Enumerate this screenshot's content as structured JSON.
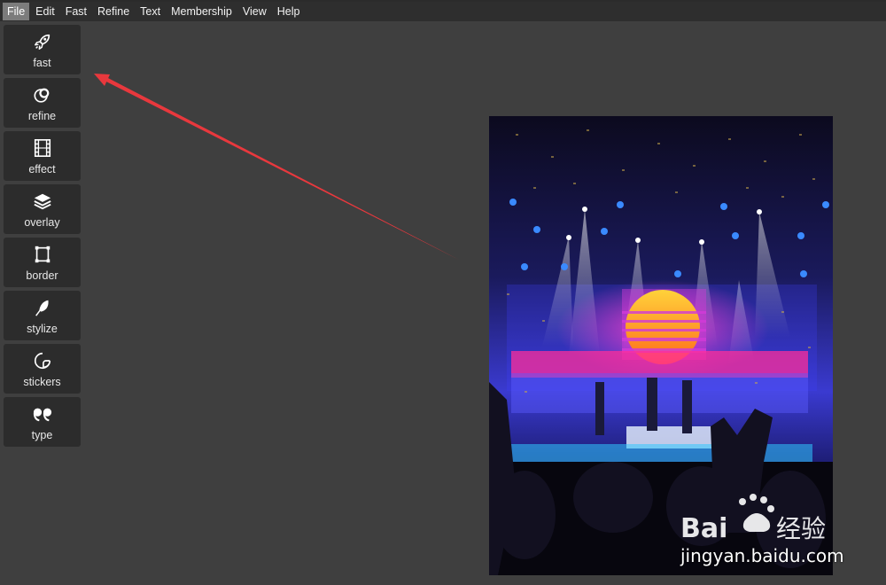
{
  "menu": {
    "items": [
      "File",
      "Edit",
      "Fast",
      "Refine",
      "Text",
      "Membership",
      "View",
      "Help"
    ],
    "active": "File"
  },
  "tools": [
    {
      "label": "fast",
      "icon": "rocket-icon"
    },
    {
      "label": "refine",
      "icon": "circles-icon"
    },
    {
      "label": "effect",
      "icon": "film-icon"
    },
    {
      "label": "overlay",
      "icon": "layers-icon"
    },
    {
      "label": "border",
      "icon": "border-frame-icon"
    },
    {
      "label": "stylize",
      "icon": "feather-icon"
    },
    {
      "label": "stickers",
      "icon": "sticker-icon"
    },
    {
      "label": "type",
      "icon": "quote-icon"
    }
  ],
  "watermark": {
    "logo_text": "Baidu经验",
    "domain": "jingyan.baidu.com"
  },
  "colors": {
    "background": "#3f3f3f",
    "menubar": "#2e2e2e",
    "tool_button": "#2c2c2c",
    "arrow": "#e8383d"
  }
}
